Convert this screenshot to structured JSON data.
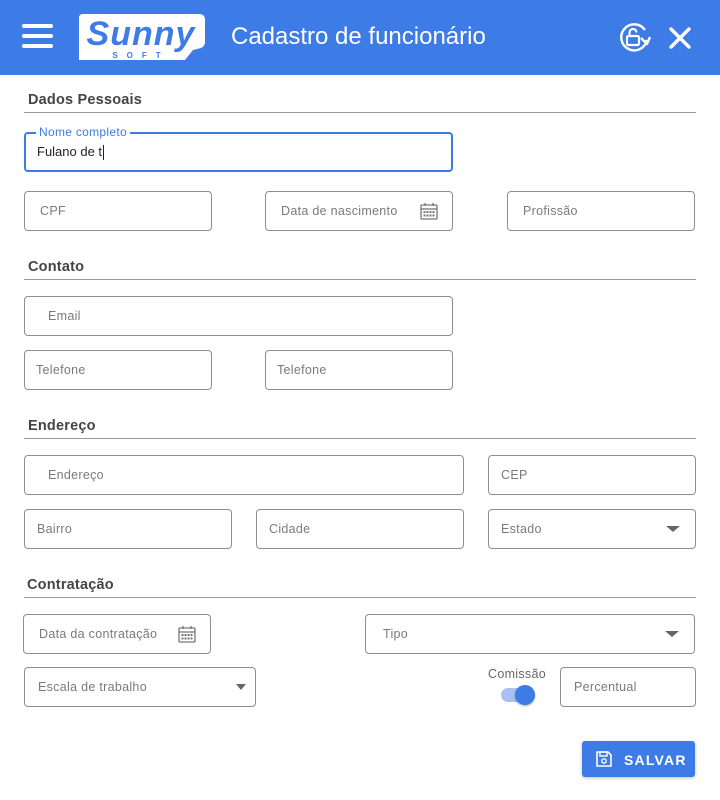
{
  "header": {
    "title": "Cadastro de funcionário",
    "logo_text": "Sunny",
    "logo_subtext": "SOFT",
    "icons": {
      "menu": "menu-icon",
      "unlock": "unlock-refresh-icon",
      "close": "close-icon"
    },
    "color": "#3d7be6"
  },
  "sections": {
    "personal": {
      "title": "Dados Pessoais",
      "full_name": {
        "label": "Nome completo",
        "value": "Fulano de t"
      },
      "cpf": "CPF",
      "birth_date": "Data de nascimento",
      "profession": "Profissão"
    },
    "contact": {
      "title": "Contato",
      "email": "Email",
      "phone_1": "Telefone",
      "phone_2": "Telefone"
    },
    "address": {
      "title": "Endereço",
      "street": "Endereço",
      "zip": "CEP",
      "district": "Bairro",
      "city": "Cidade",
      "state": "Estado"
    },
    "hiring": {
      "title": "Contratação",
      "hire_date": "Data da contratação",
      "type": "Tipo",
      "schedule": "Escala de trabalho",
      "commission": {
        "label": "Comissão",
        "on": true
      },
      "percent": "Percentual"
    }
  },
  "actions": {
    "save": "SALVAR"
  }
}
